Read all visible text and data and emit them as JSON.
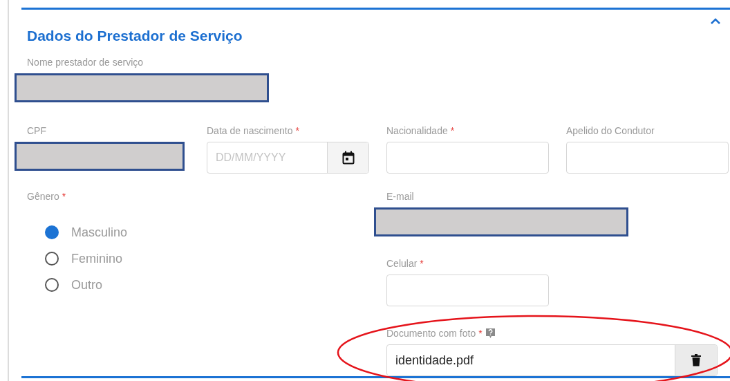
{
  "section": {
    "title": "Dados do Prestador de Serviço",
    "expanded": true
  },
  "name_field": {
    "label": "Nome prestador de serviço",
    "redacted": true
  },
  "row_fields": [
    {
      "label": "CPF",
      "redacted": true
    },
    {
      "label": "Data de nascimento",
      "mark": "*",
      "kind": "date",
      "placeholder": "DD/MM/YYYY"
    },
    {
      "label": "Nacionalidade",
      "mark": "*",
      "kind": "text"
    },
    {
      "label": "Apelido do Condutor",
      "kind": "text"
    }
  ],
  "gender": {
    "label": "Gênero",
    "mark": "*",
    "options": [
      {
        "label": "Masculino",
        "selected": true
      },
      {
        "label": "Feminino",
        "selected": false
      },
      {
        "label": "Outro",
        "selected": false
      }
    ]
  },
  "right_fields": [
    {
      "label": "E-mail",
      "redacted": true
    },
    {
      "label": "Celular",
      "mark": "*",
      "kind": "text"
    },
    {
      "label": "Documento com foto",
      "mark": "*",
      "kind": "file",
      "help": true,
      "value": "identidade.pdf",
      "circled": true
    }
  ]
}
